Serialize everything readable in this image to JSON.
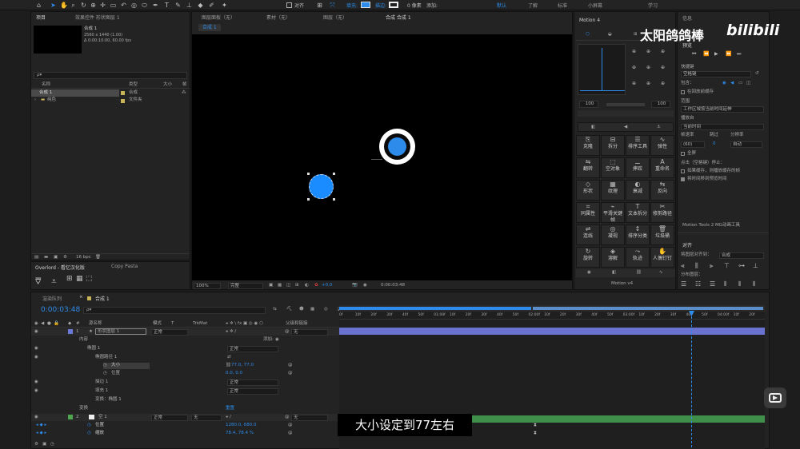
{
  "toolbar": {
    "align_label": "对齐",
    "fill_label": "填充:",
    "stroke_label": "描边:",
    "stroke_value": "0 像素",
    "add_label": "添加:",
    "workspaces": [
      "默认",
      "了解",
      "标准",
      "小屏幕",
      "学习"
    ]
  },
  "project": {
    "tab_project": "项目",
    "tab_effects": "效果控件 形状图层 1",
    "comp_name": "合成 1",
    "comp_size": "2560 x 1440 (1.00)",
    "comp_duration": "Δ 0:00:10:00, 60.00 fps",
    "search_placeholder": "ρ▾",
    "col_name": "名称",
    "col_type": "类型",
    "col_size": "大小",
    "col_fps": "帧",
    "items": [
      {
        "name": "合成 1",
        "type": "合成"
      },
      {
        "name": "纯色",
        "type": "文件夹"
      }
    ],
    "bpc": "16 bpc"
  },
  "overlord": {
    "tab_overlord": "Overlord - 看忆汉化版",
    "tab_copypasta": "Copy Pasta"
  },
  "viewer": {
    "tab_layer": "图层面板（无）",
    "tab_footage": "素材（无）",
    "tab_layer2": "图层（无）",
    "tab_comp": "合成 合成 1",
    "breadcrumb": "合成 1",
    "zoom": "100%",
    "quality": "完整",
    "exposure": "+0.0",
    "timecode": "0:00:03:48"
  },
  "motion": {
    "title": "Motion 4",
    "field_left": "100",
    "field_right": "100",
    "buttons": [
      "克隆",
      "拆分",
      "排序工具",
      "弹性",
      "翻转",
      "空对象",
      "摔跤",
      "重命名",
      "形状",
      "纹理",
      "衰减",
      "反向",
      "同属性",
      "平滑关键帧",
      "文本拆分",
      "修剪路径",
      "连线",
      "凝视",
      "排序分类",
      "垃圾桶",
      "旋转",
      "溶解",
      "轨迹",
      "人偶钉钉"
    ],
    "version": "Motion v4"
  },
  "preview": {
    "tab_info": "信息",
    "tab_preview": "预览",
    "shortcut_label": "快捷键",
    "shortcut_value": "空格键",
    "include_label": "包含：",
    "cache_label": "在回放前缓存",
    "range_label": "范围",
    "range_value": "工作区域按当前时间延伸",
    "playfrom_label": "播放自",
    "playfrom_value": "当前时间",
    "fps_label": "帧速率",
    "skip_label": "跳过",
    "res_label": "分辨率",
    "fps_value": "(60)",
    "skip_value": "0",
    "res_value": "自动",
    "fullscreen_label": "全屏",
    "stop_label": "点击（空格键）停止：",
    "stop_opt1": "如果缓存，则播放缓存的帧",
    "stop_opt2": "将时间移到预览时间",
    "tools_label": "Motion Tools 2 MG动画工具",
    "align_tab": "对齐",
    "align_to_label": "将图层对齐到：",
    "align_to_value": "合成",
    "distribute_label": "分布图层："
  },
  "timeline": {
    "tab_render": "渲染队列",
    "tab_comp": "合成 1",
    "timecode": "0:00:03:48",
    "search_placeholder": "ρ▾",
    "col_source": "源名称",
    "col_mode": "模式",
    "col_trkmat": "TrkMat",
    "col_parent": "父级和链接",
    "ruler": [
      "0f",
      "10f",
      "20f",
      "30f",
      "40f",
      "50f",
      "01:00f",
      "10f",
      "20f",
      "30f",
      "40f",
      "50f",
      "02:00f",
      "10f",
      "20f",
      "30f",
      "40f",
      "50f",
      "03:00f",
      "10f",
      "20f",
      "30f",
      "40f",
      "50f",
      "04:00f",
      "10f",
      "20f"
    ],
    "layer1_num": "1",
    "layer1_name": "形状图层 1",
    "normal": "正常",
    "none": "无",
    "add_label": "添加:",
    "content": "内容",
    "ellipse1": "椭圆 1",
    "ellipse_path": "椭圆路径 1",
    "size_label": "大小",
    "size_value": "77.0, 77.0",
    "position_label": "位置",
    "position_value": "0.0, 0.0",
    "stroke1": "描边 1",
    "fill1": "填充 1",
    "transform_ellipse": "变换：椭圆 1",
    "transform": "变换",
    "reset": "重置",
    "layer2_num": "2",
    "layer2_name": "空 1",
    "pos2_label": "位置",
    "pos2_value": "1280.0, 680.0",
    "scale_label": "缩放",
    "scale_value": "78.4, 78.4 %"
  },
  "watermark": {
    "channel": "太阳鸽鸽棒",
    "brand": "bilibili"
  },
  "subtitle": "大小设定到77左右"
}
